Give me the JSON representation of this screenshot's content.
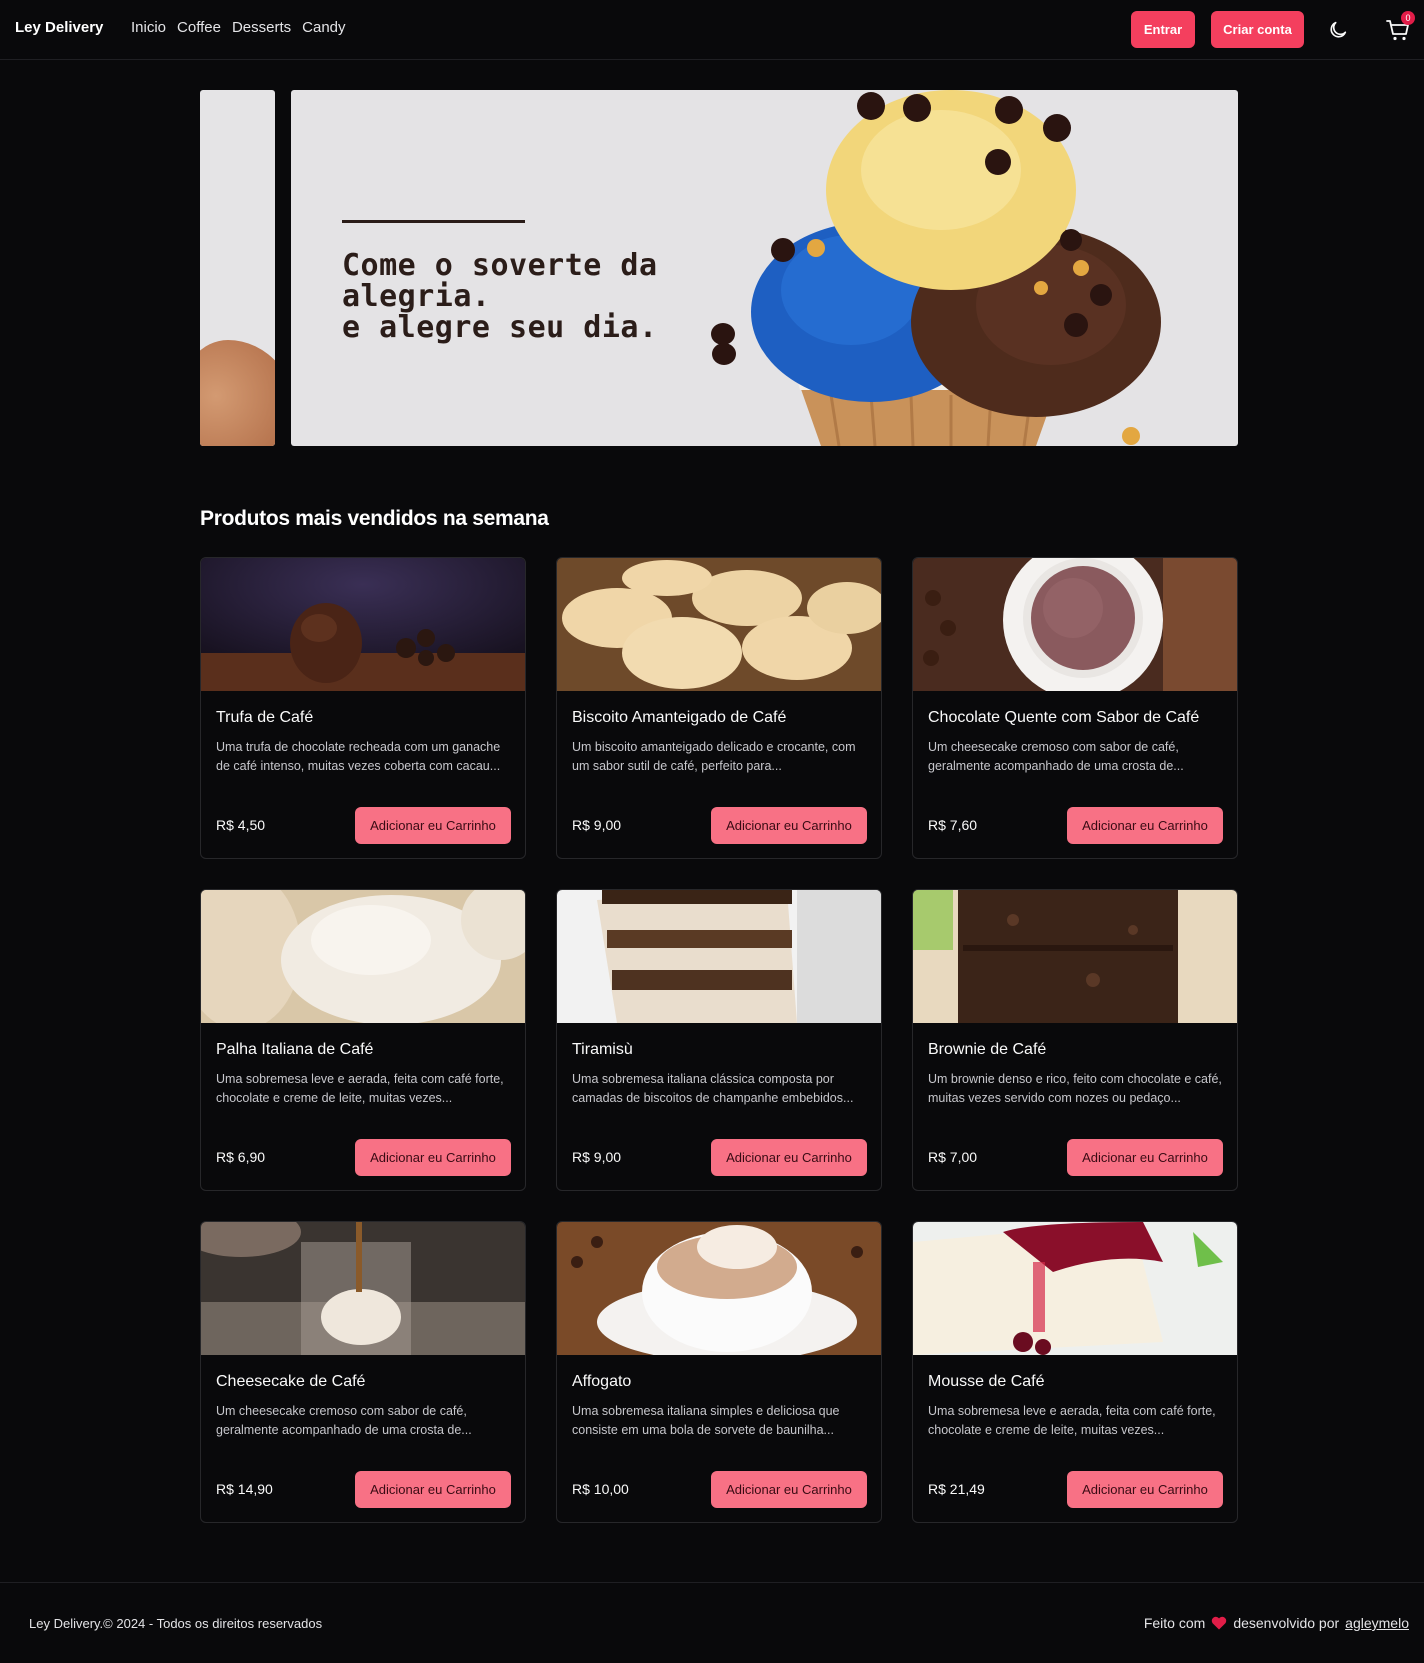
{
  "header": {
    "brand": "Ley Delivery",
    "nav": [
      "Inicio",
      "Coffee",
      "Desserts",
      "Candy"
    ],
    "login_label": "Entrar",
    "signup_label": "Criar conta",
    "cart_count": "0"
  },
  "hero": {
    "lines": [
      "Come o soverte da",
      "alegria.",
      "e alegre seu dia."
    ]
  },
  "section": {
    "title": "Produtos mais vendidos na semana",
    "add_label": "Adicionar eu Carrinho"
  },
  "products": [
    {
      "name": "Trufa de Café",
      "desc": "Uma trufa de chocolate recheada com um ganache de café intenso, muitas vezes coberta com cacau...",
      "price": "R$ 4,50",
      "image": "chocolate-truffle"
    },
    {
      "name": "Biscoito Amanteigado de Café",
      "desc": "Um biscoito amanteigado delicado e crocante, com um sabor sutil de café, perfeito para...",
      "price": "R$ 9,00",
      "image": "butter-cookies"
    },
    {
      "name": "Chocolate Quente com Sabor de Café",
      "desc": "Um cheesecake cremoso com sabor de café, geralmente acompanhado de uma crosta de...",
      "price": "R$ 7,60",
      "image": "hot-chocolate-cup"
    },
    {
      "name": "Palha Italiana de Café",
      "desc": "Uma sobremesa leve e aerada, feita com café forte, chocolate e creme de leite, muitas vezes...",
      "price": "R$ 6,90",
      "image": "meringue"
    },
    {
      "name": "Tiramisù",
      "desc": "Uma sobremesa italiana clássica composta por camadas de biscoitos de champanhe embebidos...",
      "price": "R$ 9,00",
      "image": "tiramisu-slice"
    },
    {
      "name": "Brownie de Café",
      "desc": "Um brownie denso e rico, feito com chocolate e café, muitas vezes servido com nozes ou pedaço...",
      "price": "R$ 7,00",
      "image": "brownie"
    },
    {
      "name": "Cheesecake de Café",
      "desc": "Um cheesecake cremoso com sabor de café, geralmente acompanhado de uma crosta de...",
      "price": "R$ 14,90",
      "image": "affogato-glass"
    },
    {
      "name": "Affogato",
      "desc": "Uma sobremesa italiana simples e deliciosa que consiste em uma bola de sorvete de baunilha...",
      "price": "R$ 10,00",
      "image": "cappuccino-cup"
    },
    {
      "name": "Mousse de Café",
      "desc": "Uma sobremesa leve e aerada, feita com café forte, chocolate e creme de leite, muitas vezes...",
      "price": "R$ 21,49",
      "image": "berry-cheesecake"
    }
  ],
  "footer": {
    "copyright": "Ley Delivery.© 2024 - Todos os direitos reservados",
    "made_with": "Feito com",
    "developed_by": "desenvolvido por",
    "author": "agleymelo"
  },
  "colors": {
    "accent": "#f43f5e",
    "button_soft": "#f87185",
    "background": "#09090b",
    "border": "#27272a"
  }
}
